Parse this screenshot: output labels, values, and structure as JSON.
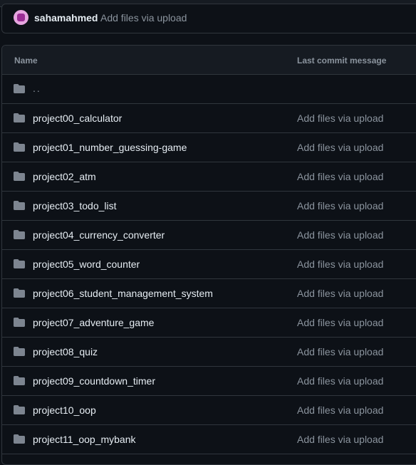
{
  "latest_commit": {
    "user": "sahamahmed",
    "message": "Add files via upload"
  },
  "table": {
    "headers": {
      "name": "Name",
      "last_commit_message": "Last commit message"
    },
    "parent_dir": "..",
    "rows": [
      {
        "name": "project00_calculator",
        "message": "Add files via upload"
      },
      {
        "name": "project01_number_guessing-game",
        "message": "Add files via upload"
      },
      {
        "name": "project02_atm",
        "message": "Add files via upload"
      },
      {
        "name": "project03_todo_list",
        "message": "Add files via upload"
      },
      {
        "name": "project04_currency_converter",
        "message": "Add files via upload"
      },
      {
        "name": "project05_word_counter",
        "message": "Add files via upload"
      },
      {
        "name": "project06_student_management_system",
        "message": "Add files via upload"
      },
      {
        "name": "project07_adventure_game",
        "message": "Add files via upload"
      },
      {
        "name": "project08_quiz",
        "message": "Add files via upload"
      },
      {
        "name": "project09_countdown_timer",
        "message": "Add files via upload"
      },
      {
        "name": "project10_oop",
        "message": "Add files via upload"
      },
      {
        "name": "project11_oop_mybank",
        "message": "Add files via upload"
      }
    ]
  },
  "icons": {
    "row_icon": "folder-icon",
    "avatar": "user-avatar"
  },
  "colors": {
    "background": "#0d1117",
    "header_background": "#161b22",
    "border": "#30363d",
    "text": "#e6edf3",
    "muted_text": "#8b949e",
    "folder_icon": "#7d8590"
  }
}
